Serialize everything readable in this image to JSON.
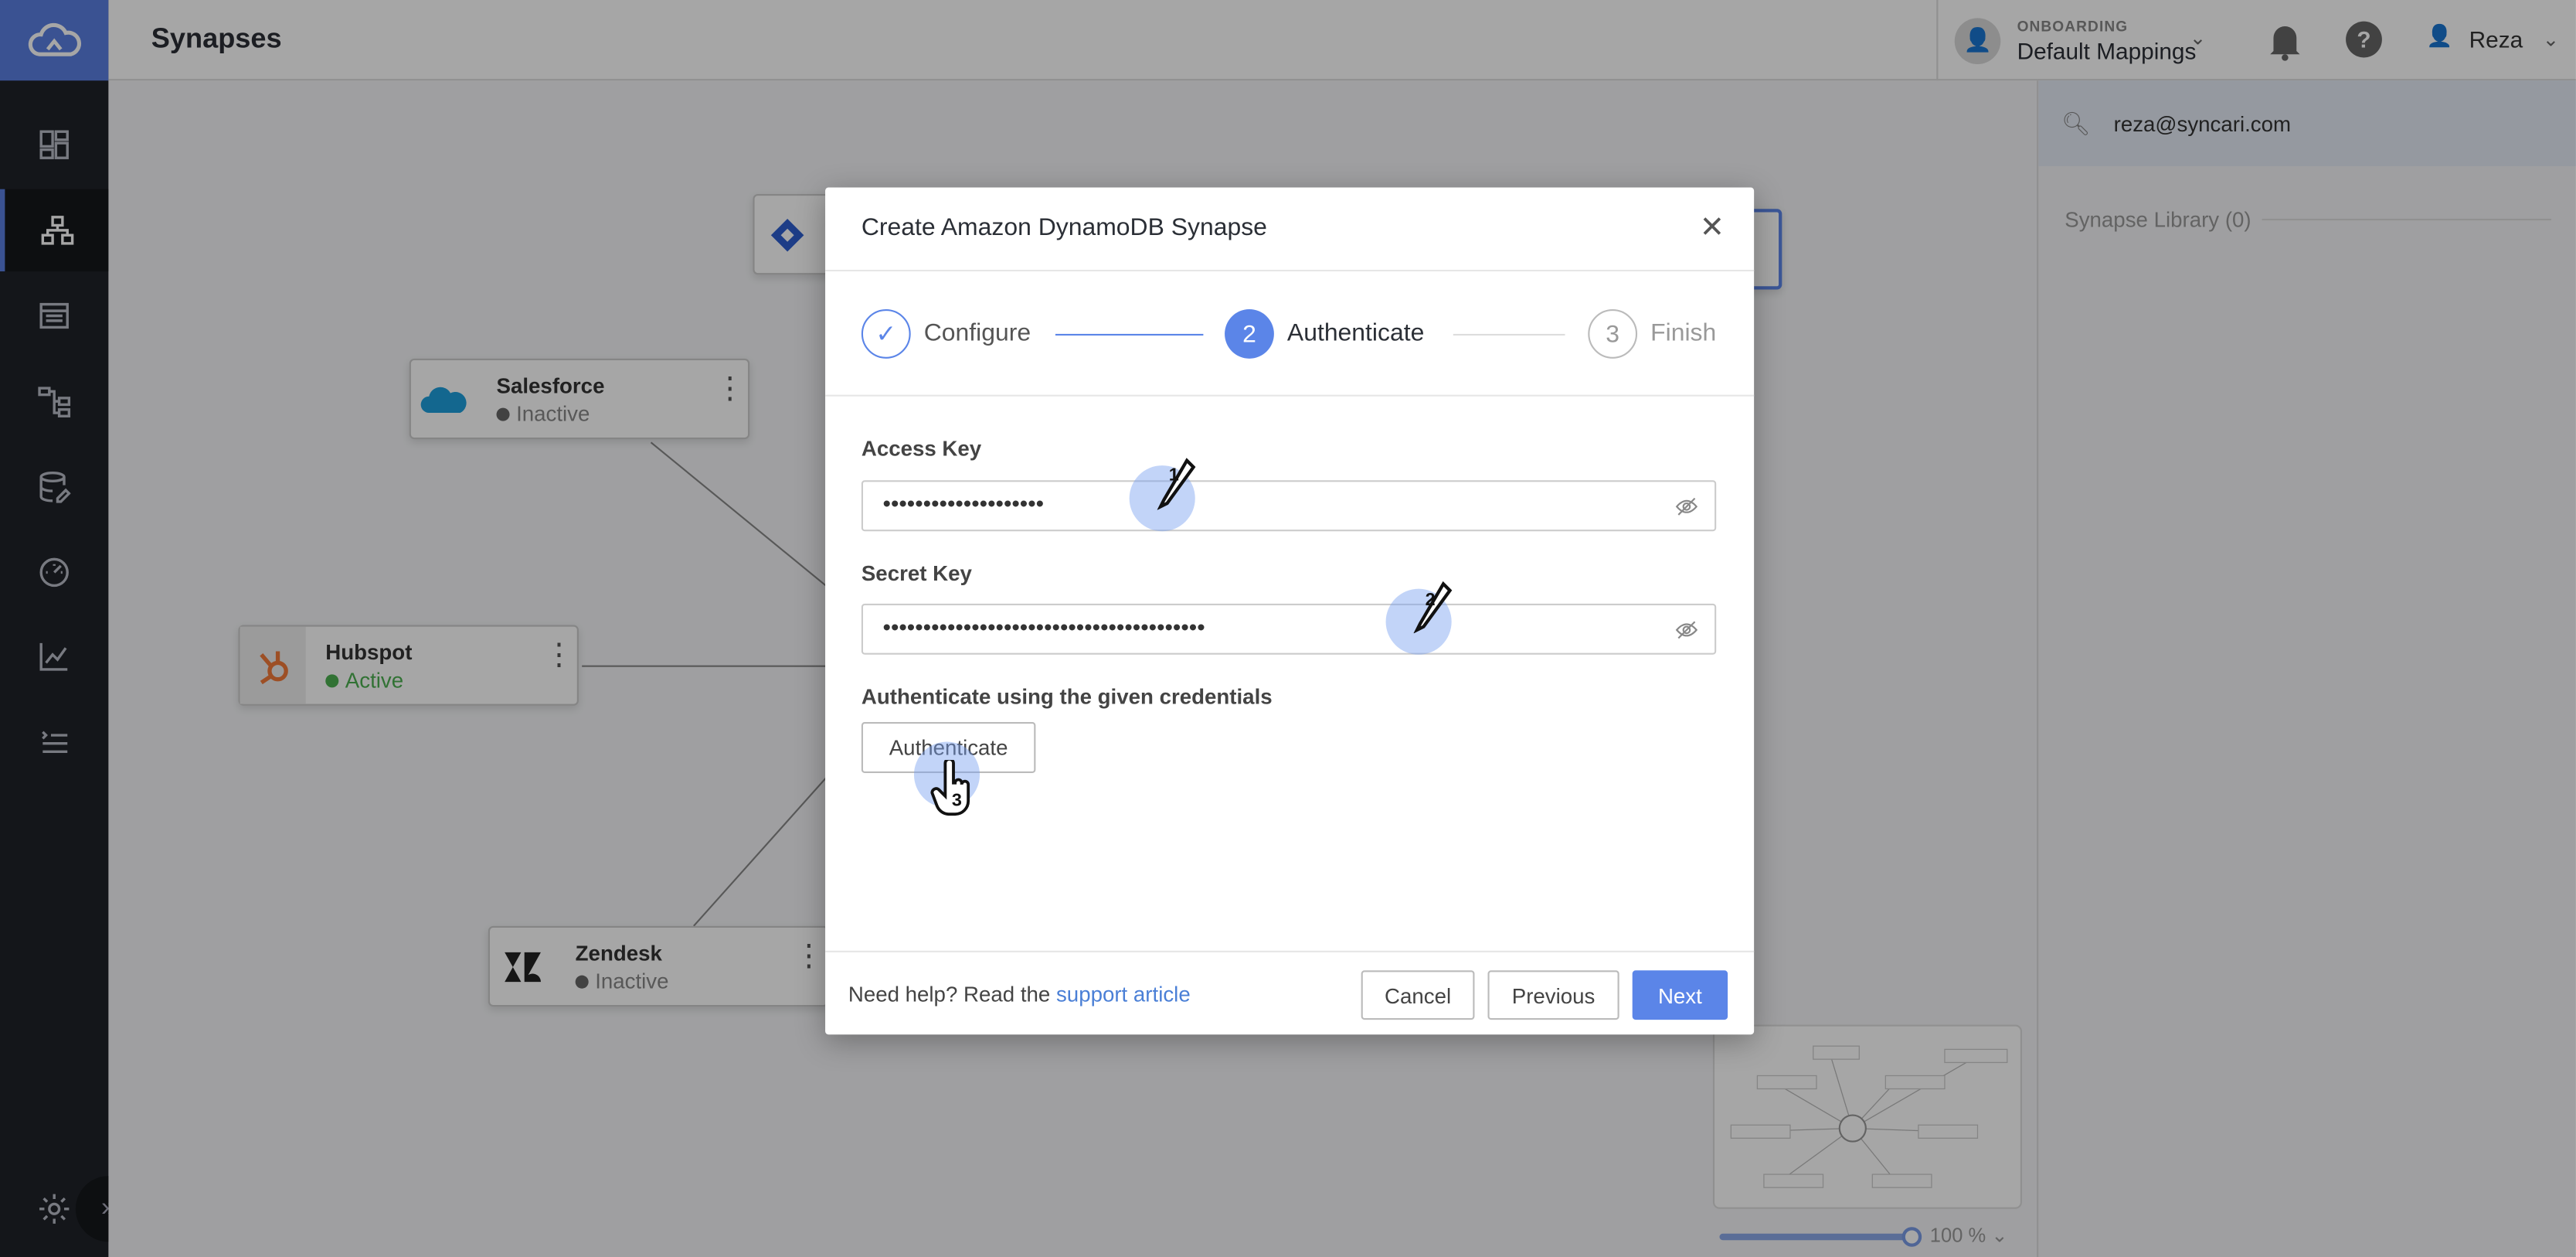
{
  "header": {
    "title": "Synapses",
    "onboarding_label": "ONBOARDING",
    "onboarding_value": "Default Mappings",
    "user_name": "Reza"
  },
  "sidebar": {
    "items": [
      {
        "icon": "dashboard-icon"
      },
      {
        "icon": "synapses-icon",
        "active": true
      },
      {
        "icon": "list-icon"
      },
      {
        "icon": "workflow-icon"
      },
      {
        "icon": "database-icon"
      },
      {
        "icon": "gauge-icon"
      },
      {
        "icon": "chart-icon"
      },
      {
        "icon": "logs-icon"
      }
    ],
    "settings_icon": "gear-icon",
    "expand_icon": "double-chevron-right-icon"
  },
  "canvas": {
    "nodes": [
      {
        "name": "Salesforce",
        "status": "Inactive"
      },
      {
        "name": "Hubspot",
        "status": "Active"
      },
      {
        "name": "Zendesk",
        "status": "Inactive"
      }
    ],
    "zoom": "100 %"
  },
  "right_panel": {
    "search_value": "reza@syncari.com",
    "library_label": "Synapse Library (0)"
  },
  "modal": {
    "title": "Create Amazon DynamoDB Synapse",
    "steps": [
      {
        "number": "1",
        "label": "Configure",
        "state": "done"
      },
      {
        "number": "2",
        "label": "Authenticate",
        "state": "active"
      },
      {
        "number": "3",
        "label": "Finish",
        "state": "pending"
      }
    ],
    "access_key_label": "Access Key",
    "access_key_value": "••••••••••••••••••••",
    "secret_key_label": "Secret Key",
    "secret_key_value": "••••••••••••••••••••••••••••••••••••••••",
    "auth_hint": "Authenticate using the given credentials",
    "auth_button": "Authenticate",
    "help_prefix": "Need help? Read the",
    "help_link": "support article",
    "cancel": "Cancel",
    "previous": "Previous",
    "next": "Next"
  },
  "annotations": [
    "1",
    "2",
    "3"
  ],
  "colors": {
    "accent": "#5b85e8",
    "sidebar": "#1f2228",
    "active_status": "#4caf50"
  }
}
